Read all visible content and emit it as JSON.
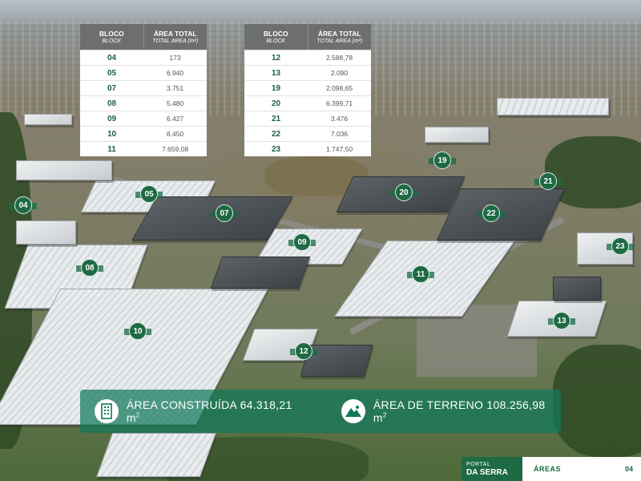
{
  "tables": [
    {
      "header": {
        "block": "BLOCO",
        "block_en": "BLOCK",
        "area": "ÁREA TOTAL",
        "area_en": "TOTAL AREA (m²)"
      },
      "rows": [
        {
          "block": "04",
          "area": "173"
        },
        {
          "block": "05",
          "area": "6.940"
        },
        {
          "block": "07",
          "area": "3.751"
        },
        {
          "block": "08",
          "area": "5.480"
        },
        {
          "block": "09",
          "area": "6.427"
        },
        {
          "block": "10",
          "area": "8.450"
        },
        {
          "block": "11",
          "area": "7.659,08"
        }
      ]
    },
    {
      "header": {
        "block": "BLOCO",
        "block_en": "BLOCK",
        "area": "ÁREA TOTAL",
        "area_en": "TOTAL AREA (m²)"
      },
      "rows": [
        {
          "block": "12",
          "area": "2.588,78"
        },
        {
          "block": "13",
          "area": "2.090"
        },
        {
          "block": "19",
          "area": "2.098,65"
        },
        {
          "block": "20",
          "area": "6.399,71"
        },
        {
          "block": "21",
          "area": "3.476"
        },
        {
          "block": "22",
          "area": "7.036"
        },
        {
          "block": "23",
          "area": "1.747,50"
        }
      ]
    }
  ],
  "markers": [
    "04",
    "05",
    "07",
    "08",
    "09",
    "10",
    "11",
    "12",
    "13",
    "19",
    "20",
    "21",
    "22",
    "23"
  ],
  "summary": {
    "built_icon": "building-icon",
    "built_label": "ÁREA CONSTRUÍDA",
    "built_value": "64.318,21 m",
    "built_unit_sup": "2",
    "land_icon": "terrain-icon",
    "land_label": "ÁREA DE TERRENO",
    "land_value": "108.256,98 m",
    "land_unit_sup": "2"
  },
  "footer": {
    "logo_line1": "PORTAL",
    "logo_line2": "DA SERRA",
    "section": "ÁREAS",
    "page": "04"
  },
  "colors": {
    "brand_green": "#1d6a43",
    "table_header": "#6c6f6e",
    "banner": "#10785a"
  }
}
